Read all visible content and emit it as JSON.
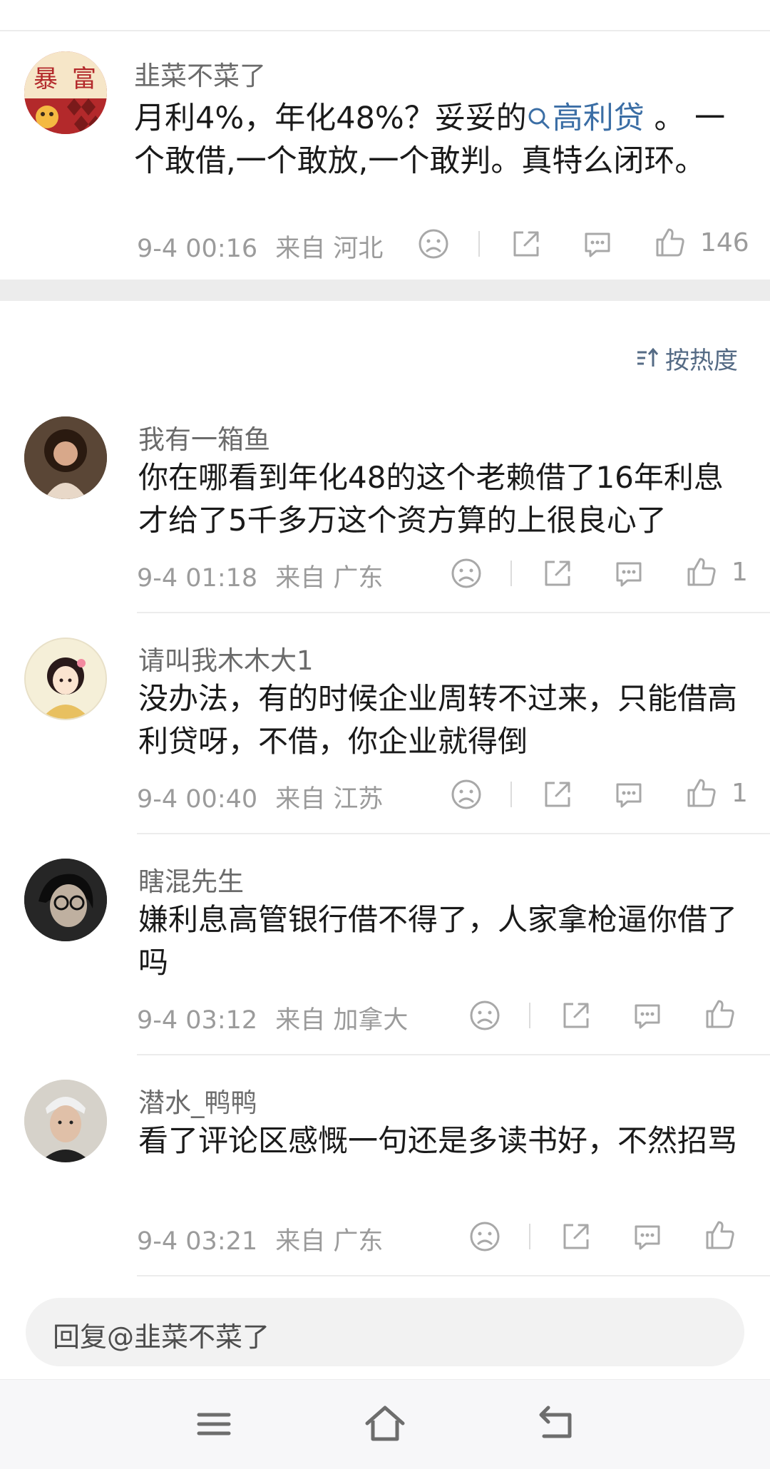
{
  "main_comment": {
    "username": "韭菜不菜了",
    "avatar_text": [
      "暴",
      "富"
    ],
    "text_before": "月利4%，年化48%？妥妥的",
    "link_text": "高利贷",
    "text_after": " 。 一个敢借,一个敢放,一个敢判。真特么闭环。",
    "time": "9-4 00:16",
    "location": "来自 河北",
    "likes": "146"
  },
  "sort_label": "按热度",
  "replies": [
    {
      "username": "我有一箱鱼",
      "text": "你在哪看到年化48的这个老赖借了16年利息才给了5千多万这个资方算的上很良心了",
      "time": "9-4 01:18",
      "location": "来自 广东",
      "likes": "1"
    },
    {
      "username": "请叫我木木大1",
      "text": "没办法，有的时候企业周转不过来，只能借高利贷呀，不借，你企业就得倒",
      "time": "9-4 00:40",
      "location": "来自 江苏",
      "likes": "1"
    },
    {
      "username": "瞎混先生",
      "text": "嫌利息高管银行借不得了，人家拿枪逼你借了吗",
      "time": "9-4 03:12",
      "location": "来自 加拿大",
      "likes": ""
    },
    {
      "username": "潜水_鸭鸭",
      "text": "看了评论区感慨一句还是多读书好，不然招骂",
      "time": "9-4 03:21",
      "location": "来自 广东",
      "likes": ""
    }
  ],
  "reply_box": {
    "placeholder": "回复@韭菜不菜了"
  },
  "icons": {
    "dislike": "frown-icon",
    "share": "share-icon",
    "comment": "comment-icon",
    "like": "thumbs-up-icon",
    "sort": "sort-icon",
    "menu": "menu-icon",
    "home": "home-icon",
    "back": "back-icon"
  },
  "colors": {
    "link": "#3b6ea5",
    "sort": "#556b85",
    "meta_gray": "#9b9b9b"
  }
}
